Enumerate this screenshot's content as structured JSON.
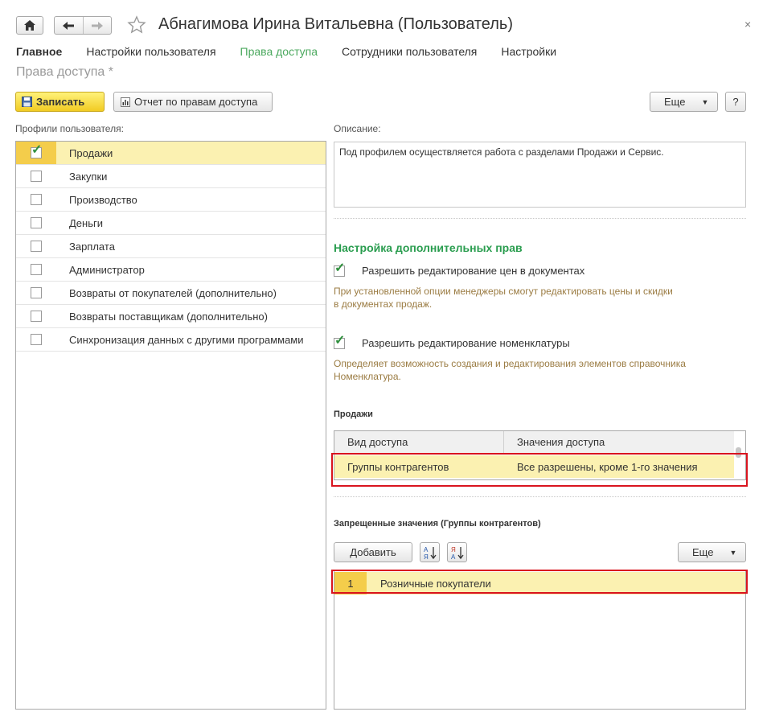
{
  "window": {
    "title": "Абнагимова Ирина Витальевна (Пользователь)",
    "close_glyph": "×"
  },
  "tabs": [
    {
      "label": "Главное",
      "bold": true,
      "active": false
    },
    {
      "label": "Настройки пользователя",
      "bold": false,
      "active": false
    },
    {
      "label": "Права доступа",
      "bold": false,
      "active": true
    },
    {
      "label": "Сотрудники пользователя",
      "bold": false,
      "active": false
    },
    {
      "label": "Настройки",
      "bold": false,
      "active": false
    }
  ],
  "page_title": "Права доступа *",
  "toolbar": {
    "save_label": "Записать",
    "report_label": "Отчет по правам доступа",
    "more_label": "Еще",
    "help_label": "?"
  },
  "profiles": {
    "label": "Профили пользователя:",
    "items": [
      {
        "label": "Продажи",
        "checked": true,
        "selected": true
      },
      {
        "label": "Закупки",
        "checked": false,
        "selected": false
      },
      {
        "label": "Производство",
        "checked": false,
        "selected": false
      },
      {
        "label": "Деньги",
        "checked": false,
        "selected": false
      },
      {
        "label": "Зарплата",
        "checked": false,
        "selected": false
      },
      {
        "label": "Администратор",
        "checked": false,
        "selected": false
      },
      {
        "label": "Возвраты от покупателей (дополнительно)",
        "checked": false,
        "selected": false
      },
      {
        "label": "Возвраты поставщикам (дополнительно)",
        "checked": false,
        "selected": false
      },
      {
        "label": "Синхронизация данных с другими программами",
        "checked": false,
        "selected": false
      }
    ]
  },
  "description": {
    "label": "Описание:",
    "text": "Под профилем осуществляется работа с разделами Продажи и Сервис."
  },
  "extra_rights": {
    "title": "Настройка дополнительных прав",
    "options": [
      {
        "label": "Разрешить редактирование цен в документах",
        "checked": true,
        "hint_line1": "При установленной опции менеджеры смогут редактировать цены и скидки",
        "hint_line2": "в документах продаж."
      },
      {
        "label": "Разрешить редактирование номенклатуры",
        "checked": true,
        "hint_line1": "Определяет возможность создания и редактирования элементов справочника",
        "hint_line2": "Номенклатура."
      }
    ]
  },
  "sales": {
    "title": "Продажи",
    "columns": [
      "Вид доступа",
      "Значения доступа"
    ],
    "rows": [
      {
        "kind": "Группы контрагентов",
        "value": "Все разрешены, кроме 1-го значения"
      }
    ]
  },
  "forbidden": {
    "title": "Запрещенные значения (Группы контрагентов)",
    "add_label": "Добавить",
    "more_label": "Еще",
    "rows": [
      {
        "num": "1",
        "value": "Розничные покупатели"
      }
    ]
  },
  "colors": {
    "accent_green": "#4ca95f",
    "section_green": "#2a9d4f",
    "selection": "#fbf1b1",
    "selection_strong": "#f4cd4b",
    "highlight_frame": "#d9141e",
    "hint_text": "#9b7c43"
  }
}
